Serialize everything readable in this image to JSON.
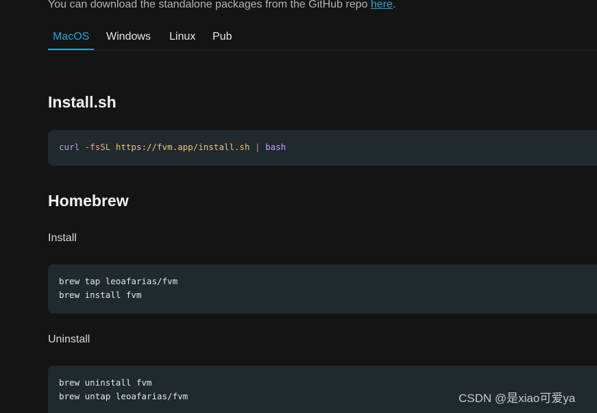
{
  "intro": {
    "text": "You can download the standalone packages from the GitHub repo ",
    "link_label": "here",
    "trailing": "."
  },
  "tabs": [
    {
      "label": "MacOS",
      "active": true
    },
    {
      "label": "Windows",
      "active": false
    },
    {
      "label": "Linux",
      "active": false
    },
    {
      "label": "Pub",
      "active": false
    }
  ],
  "sections": {
    "install_sh": {
      "heading": "Install.sh",
      "code": {
        "cmd": "curl",
        "flag": "-fsSL",
        "url": "https://fvm.app/install.sh",
        "pipe": "|",
        "shell": "bash"
      }
    },
    "homebrew": {
      "heading": "Homebrew",
      "install_label": "Install",
      "install_lines": [
        "brew tap leoafarias/fvm",
        "brew install fvm"
      ],
      "uninstall_label": "Uninstall",
      "uninstall_lines": [
        "brew uninstall fvm",
        "brew untap leoafarias/fvm"
      ]
    }
  },
  "watermark": "CSDN @是xiao可爱ya",
  "colors": {
    "background": "#141414",
    "accent": "#1fa8d8",
    "code_background": "#1f2a2e"
  }
}
